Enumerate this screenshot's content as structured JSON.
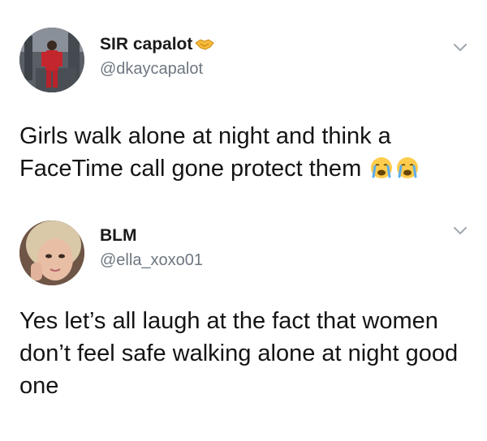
{
  "tweets": [
    {
      "display_name": "SIR capalot",
      "handle": "@dkaycapalot",
      "text": "Girls walk alone at night and think a FaceTime call gone protect them",
      "emojis": [
        "loudly-crying-face",
        "loudly-crying-face"
      ]
    },
    {
      "display_name": "BLM",
      "handle": "@ella_xoxo01",
      "text": "Yes let’s all laugh at the fact that women don’t feel safe walking alone at night good one"
    }
  ],
  "colors": {
    "text": "#141414",
    "handle": "#6e7781",
    "chevron": "#a0a7b0"
  }
}
